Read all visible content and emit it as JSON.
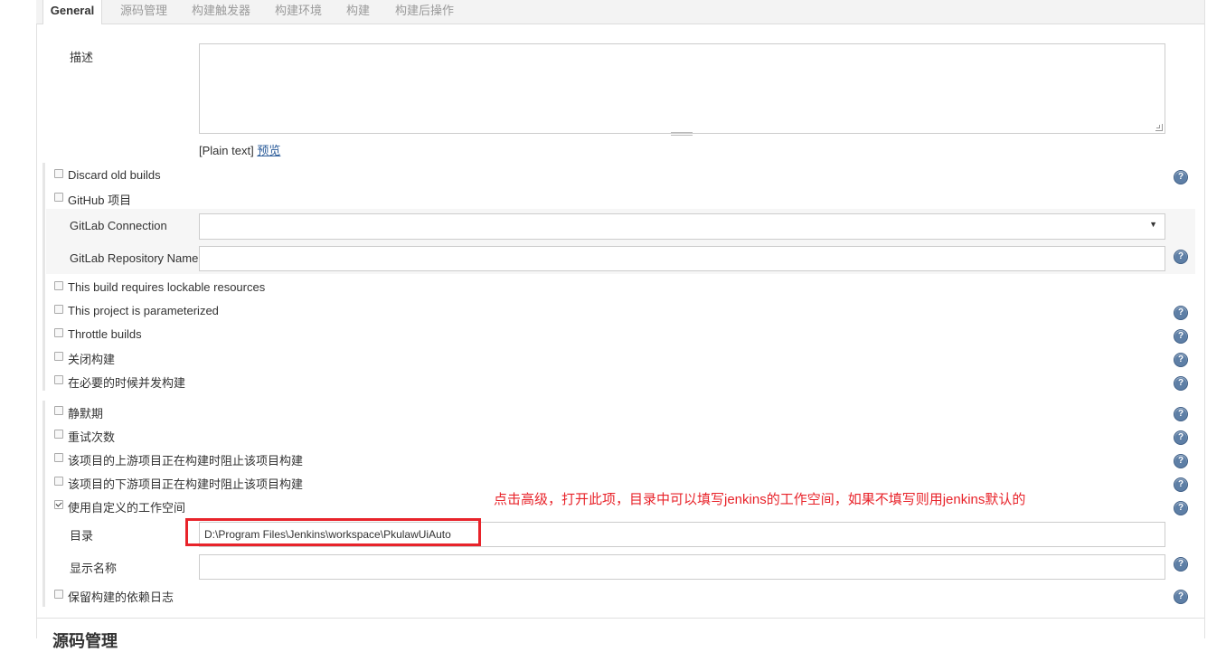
{
  "tabs": [
    {
      "label": "General",
      "active": true
    },
    {
      "label": "源码管理",
      "active": false
    },
    {
      "label": "构建触发器",
      "active": false
    },
    {
      "label": "构建环境",
      "active": false
    },
    {
      "label": "构建",
      "active": false
    },
    {
      "label": "构建后操作",
      "active": false
    }
  ],
  "description": {
    "label": "描述",
    "value": "",
    "format_text": "[Plain text]",
    "preview_link": "预览"
  },
  "options": {
    "discard_old_builds": {
      "label": "Discard old builds",
      "checked": false
    },
    "github_project": {
      "label": "GitHub 项目",
      "checked": false
    },
    "gitlab_connection": {
      "label": "GitLab Connection",
      "value": ""
    },
    "gitlab_repo_name": {
      "label": "GitLab Repository Name",
      "value": ""
    },
    "lockable_resources": {
      "label": "This build requires lockable resources",
      "checked": false
    },
    "parameterized": {
      "label": "This project is parameterized",
      "checked": false
    },
    "throttle_builds": {
      "label": "Throttle builds",
      "checked": false
    },
    "disable_build": {
      "label": "关闭构建",
      "checked": false
    },
    "concurrent_build": {
      "label": "在必要的时候并发构建",
      "checked": false
    }
  },
  "advanced": {
    "quiet_period": {
      "label": "静默期",
      "checked": false
    },
    "retry_count": {
      "label": "重试次数",
      "checked": false
    },
    "block_upstream": {
      "label": "该项目的上游项目正在构建时阻止该项目构建",
      "checked": false
    },
    "block_downstream": {
      "label": "该项目的下游项目正在构建时阻止该项目构建",
      "checked": false
    },
    "custom_workspace": {
      "label": "使用自定义的工作空间",
      "checked": true
    },
    "directory": {
      "label": "目录",
      "value": "D:\\Program Files\\Jenkins\\workspace\\PkulawUiAuto"
    },
    "display_name": {
      "label": "显示名称",
      "value": ""
    },
    "keep_dependencies": {
      "label": "保留构建的依赖日志",
      "checked": false
    }
  },
  "annotation": "点击高级，打开此项，目录中可以填写jenkins的工作空间，如果不填写则用jenkins默认的",
  "next_section_title": "源码管理",
  "help_icon_glyph": "?",
  "colors": {
    "annotation_red": "#e8232a",
    "help_icon_blue": "#5e7fa6",
    "link_blue": "#2c5c9a"
  }
}
